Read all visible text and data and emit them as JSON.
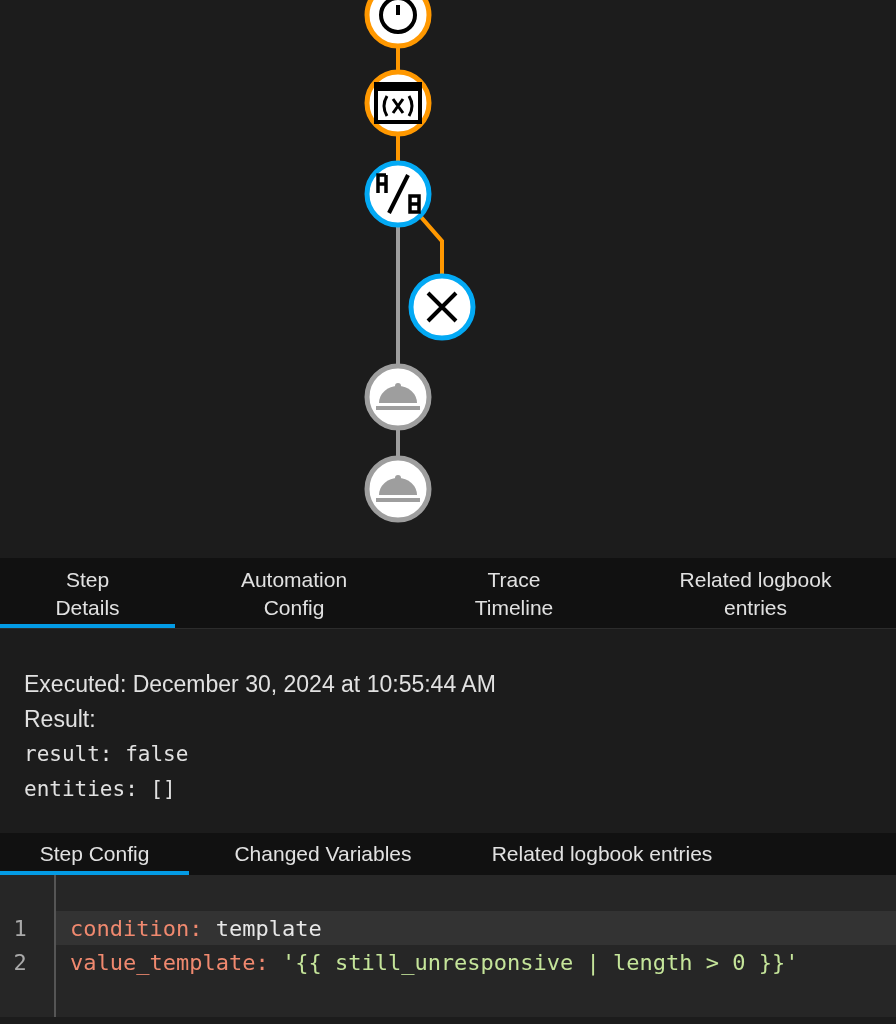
{
  "graph": {
    "nodes": [
      {
        "kind": "timer",
        "executed": true,
        "selected": false
      },
      {
        "kind": "variable",
        "executed": true,
        "selected": false
      },
      {
        "kind": "condition",
        "executed": true,
        "selected": true
      },
      {
        "kind": "stop",
        "executed": true,
        "selected": true
      },
      {
        "kind": "service",
        "executed": false,
        "selected": false
      },
      {
        "kind": "service",
        "executed": false,
        "selected": false
      }
    ],
    "edges": [
      {
        "executed": true
      },
      {
        "executed": true
      },
      {
        "executed": true
      },
      {
        "executed": false
      },
      {
        "executed": false
      }
    ]
  },
  "trace_tabs": [
    {
      "label": "Step\nDetails",
      "selected": true
    },
    {
      "label": "Automation\nConfig",
      "selected": false
    },
    {
      "label": "Trace\nTimeline",
      "selected": false
    },
    {
      "label": "Related logbook\nentries",
      "selected": false
    }
  ],
  "details": {
    "executed": "Executed: December 30, 2024 at 10:55:44 AM",
    "result_label": "Result:",
    "result_lines": [
      "result: false",
      "entities: []"
    ]
  },
  "step_tabs": [
    {
      "label": "Step Config",
      "selected": true
    },
    {
      "label": "Changed Variables",
      "selected": false
    },
    {
      "label": "Related logbook entries",
      "selected": false
    }
  ],
  "code": [
    {
      "number": "1",
      "active": true,
      "tokens": [
        {
          "kind": "key",
          "text": "condition:"
        },
        {
          "kind": "plain",
          "text": " template"
        }
      ]
    },
    {
      "number": "2",
      "active": false,
      "tokens": [
        {
          "kind": "key",
          "text": "value_template:"
        },
        {
          "kind": "string",
          "text": " '{{ still_unresponsive | length > 0 }}'"
        }
      ]
    }
  ]
}
